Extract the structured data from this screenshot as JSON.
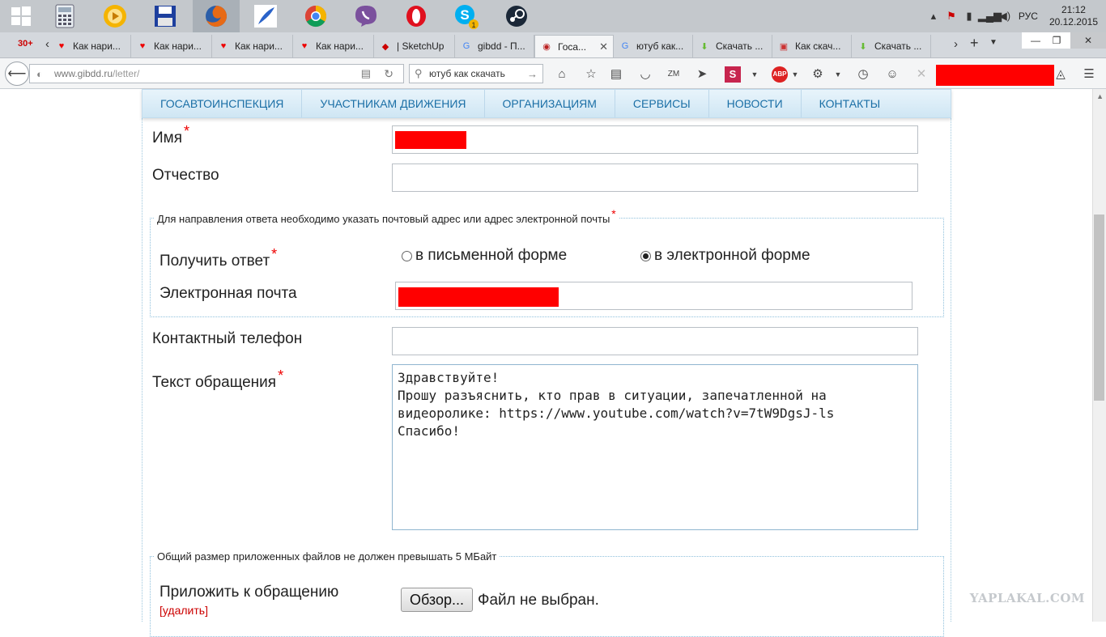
{
  "taskbar": {
    "apps": [
      "start",
      "calculator",
      "media-player",
      "save",
      "firefox",
      "quill",
      "chrome",
      "viber",
      "opera",
      "skype",
      "steam"
    ],
    "tray": {
      "lang": "РУС",
      "time": "21:12",
      "date": "20.12.2015",
      "skype_badge": "1"
    }
  },
  "tabs": [
    {
      "label": "Как нари...",
      "icon": "heart-icon"
    },
    {
      "label": "Как нари...",
      "icon": "heart-icon"
    },
    {
      "label": "Как нари...",
      "icon": "heart-icon"
    },
    {
      "label": "Как нари...",
      "icon": "heart-icon"
    },
    {
      "label": "| SketchUp",
      "icon": "sketchup-icon"
    },
    {
      "label": "gibdd - П...",
      "icon": "google-icon"
    },
    {
      "label": "Гоca...",
      "icon": "gibdd-icon"
    },
    {
      "label": "ютуб как...",
      "icon": "google-icon"
    },
    {
      "label": "Скачать ...",
      "icon": "download-icon"
    },
    {
      "label": "Как скач...",
      "icon": "vk-icon"
    },
    {
      "label": "Скачать ...",
      "icon": "download-icon"
    }
  ],
  "first_tab_badge": "30+",
  "navbar": {
    "url_host": "www.gibdd.ru",
    "url_path": "/letter/",
    "search_text": "ютуб как скачать"
  },
  "site_menu": [
    "ГОСАВТОИНСПЕКЦИЯ",
    "УЧАСТНИКАМ ДВИЖЕНИЯ",
    "ОРГАНИЗАЦИЯМ",
    "СЕРВИСЫ",
    "НОВОСТИ",
    "КОНТАКТЫ"
  ],
  "form": {
    "name_label": "Имя",
    "patronymic_label": "Отчество",
    "reply_legend": "Для направления ответа необходимо указать почтовый адрес или адрес электронной почты",
    "reply_label": "Получить ответ",
    "reply_option_paper": "в письменной форме",
    "reply_option_email": "в электронной форме",
    "reply_selected": "email",
    "email_label": "Электронная почта",
    "phone_label": "Контактный телефон",
    "text_label": "Текст обращения",
    "text_value": "Здравствуйте!\nПрошу разъяснить, кто прав в ситуации, запечатленной на\nвидеоролике: https://www.youtube.com/watch?v=7tW9DgsJ-ls\nСпасибо!",
    "files_legend": "Общий размер приложенных файлов не должен превышать 5 МБайт",
    "attach_label": "Приложить к обращению",
    "delete_link": "[удалить]",
    "browse_button": "Обзор...",
    "no_file": "Файл не выбран.",
    "required_mark": "*"
  },
  "watermark": "YAPLAKAL.COM",
  "colors": {
    "menu_text": "#1b6fa6",
    "required": "#e00000",
    "redaction": "#ff0000"
  }
}
